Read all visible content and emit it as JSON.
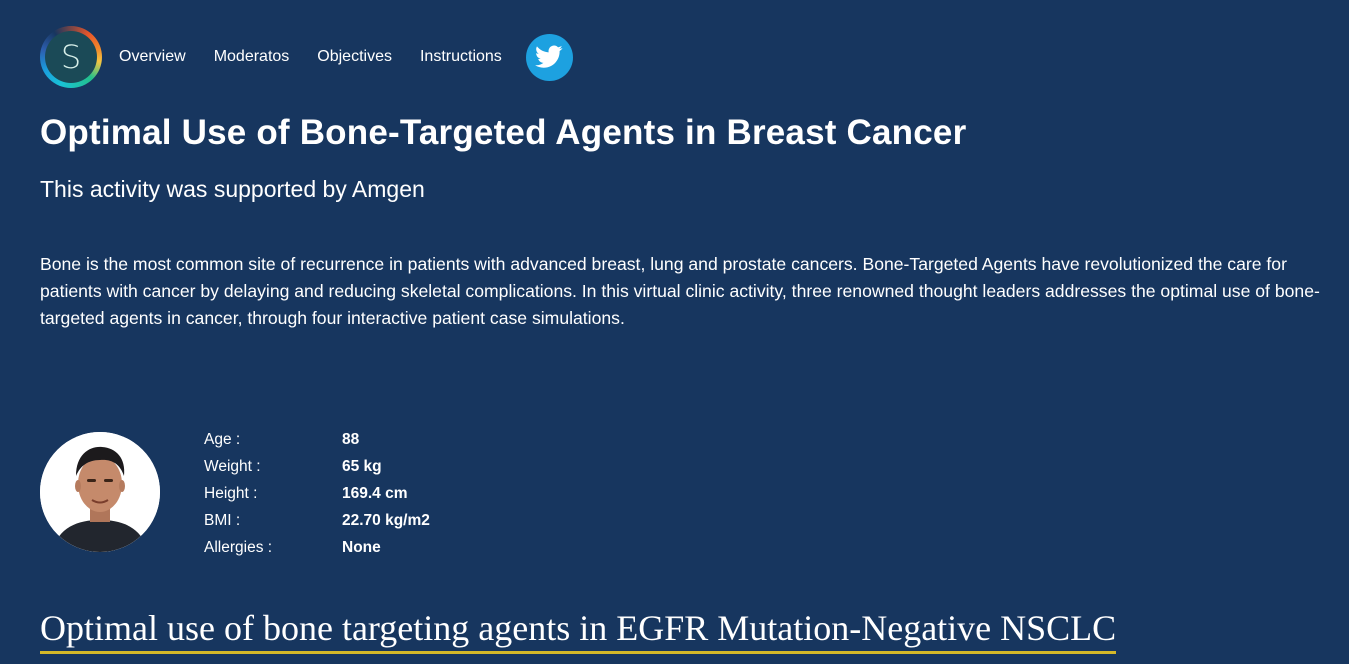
{
  "nav": {
    "logo_letter": "S",
    "links": [
      "Overview",
      "Moderatos",
      "Objectives",
      "Instructions"
    ],
    "twitter_icon": "twitter-bird-icon"
  },
  "header": {
    "title": "Optimal Use of Bone-Targeted Agents in Breast Cancer",
    "subtitle": "This activity was supported by Amgen"
  },
  "intro": "Bone is the most common site of recurrence in patients with advanced breast, lung and prostate cancers. Bone-Targeted Agents have revolutionized the care for patients with cancer by delaying and reducing skeletal complications. In this virtual clinic activity, three renowned thought leaders addresses the optimal use of bone-targeted agents in cancer, through four interactive patient case simulations.",
  "patient": {
    "stats": [
      {
        "label": "Age :",
        "value": "88"
      },
      {
        "label": "Weight :",
        "value": "65 kg"
      },
      {
        "label": "Height :",
        "value": "169.4 cm"
      },
      {
        "label": "BMI :",
        "value": "22.70 kg/m2"
      },
      {
        "label": "Allergies :",
        "value": "None"
      }
    ]
  },
  "case": {
    "title": "Optimal use of bone targeting agents in EGFR Mutation-Negative NSCLC"
  },
  "colors": {
    "background": "#17365f",
    "accent_underline": "#d4b829",
    "twitter": "#1da1e0"
  }
}
